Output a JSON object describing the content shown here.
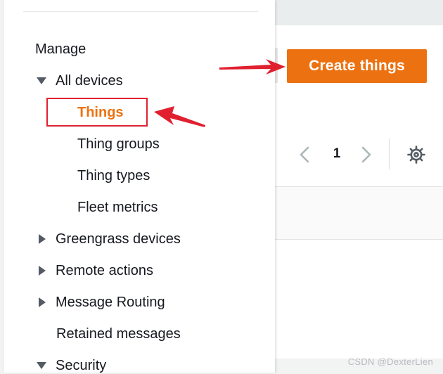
{
  "sidebar": {
    "section_title": "Manage",
    "items": [
      {
        "label": "All devices",
        "expanded": true
      },
      {
        "label": "Things",
        "active": true
      },
      {
        "label": "Thing groups"
      },
      {
        "label": "Thing types"
      },
      {
        "label": "Fleet metrics"
      },
      {
        "label": "Greengrass devices",
        "expanded": false
      },
      {
        "label": "Remote actions",
        "expanded": false
      },
      {
        "label": "Message Routing",
        "expanded": false
      },
      {
        "label": "Retained messages"
      },
      {
        "label": "Security",
        "expanded": true
      }
    ]
  },
  "toolbar": {
    "create_label": "Create things"
  },
  "pagination": {
    "current_page": "1",
    "prev_icon": "chevron-left-icon",
    "next_icon": "chevron-right-icon",
    "settings_icon": "gear-icon"
  },
  "watermark": "CSDN @DexterLien",
  "colors": {
    "accent": "#ec7211",
    "annotation": "#e0202f",
    "text": "#16191f"
  }
}
